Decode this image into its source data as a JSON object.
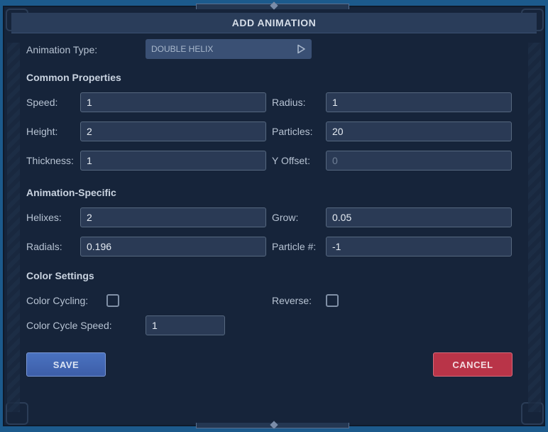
{
  "dialog": {
    "title": "ADD ANIMATION"
  },
  "animation_type": {
    "label": "Animation Type:",
    "value": "DOUBLE HELIX",
    "icon": "play-triangle-icon"
  },
  "common": {
    "heading": "Common Properties",
    "speed": {
      "label": "Speed:",
      "value": "1"
    },
    "radius": {
      "label": "Radius:",
      "value": "1"
    },
    "height": {
      "label": "Height:",
      "value": "2"
    },
    "particles": {
      "label": "Particles:",
      "value": "20"
    },
    "thickness": {
      "label": "Thickness:",
      "value": "1"
    },
    "y_offset": {
      "label": "Y Offset:",
      "value": "",
      "placeholder": "0"
    }
  },
  "specific": {
    "heading": "Animation-Specific",
    "helixes": {
      "label": "Helixes:",
      "value": "2"
    },
    "grow": {
      "label": "Grow:",
      "value": "0.05"
    },
    "radials": {
      "label": "Radials:",
      "value": "0.196"
    },
    "particle_num": {
      "label": "Particle #:",
      "value": "-1"
    }
  },
  "color": {
    "heading": "Color Settings",
    "cycling": {
      "label": "Color Cycling:",
      "checked": false
    },
    "reverse": {
      "label": "Reverse:",
      "checked": false
    },
    "cycle_speed": {
      "label": "Color Cycle Speed:",
      "value": "1"
    }
  },
  "buttons": {
    "save": "SAVE",
    "cancel": "CANCEL"
  },
  "colors": {
    "save": "#4a72c0",
    "cancel": "#b93448",
    "background": "#16243a"
  }
}
